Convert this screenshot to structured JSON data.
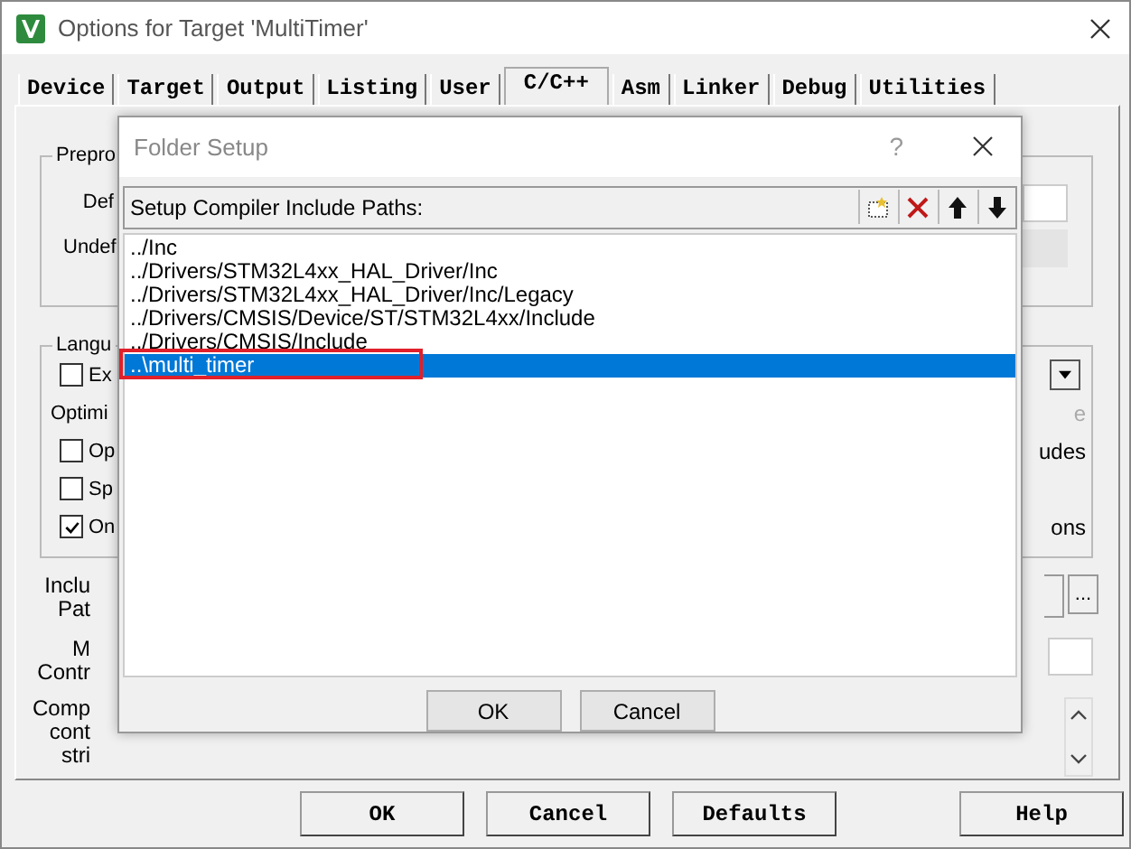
{
  "window": {
    "title": "Options for Target 'MultiTimer'"
  },
  "tabs": [
    {
      "label": "Device",
      "selected": false
    },
    {
      "label": "Target",
      "selected": false
    },
    {
      "label": "Output",
      "selected": false
    },
    {
      "label": "Listing",
      "selected": false
    },
    {
      "label": "User",
      "selected": false
    },
    {
      "label": "C/C++",
      "selected": true
    },
    {
      "label": "Asm",
      "selected": false
    },
    {
      "label": "Linker",
      "selected": false
    },
    {
      "label": "Debug",
      "selected": false
    },
    {
      "label": "Utilities",
      "selected": false
    }
  ],
  "preprocessor": {
    "legend": "Prepro",
    "rows": [
      {
        "label": "Def",
        "disabled": false
      },
      {
        "label": "Undef",
        "disabled": true
      }
    ]
  },
  "language": {
    "legend": "Langu",
    "rows": [
      {
        "kind": "checkbox",
        "label": "Ex",
        "checked": false,
        "right": {
          "kind": "dropdown"
        }
      },
      {
        "kind": "heading",
        "label": "Optimi",
        "right": {
          "kind": "text",
          "text": "e",
          "disabled": true
        }
      },
      {
        "kind": "checkbox",
        "label": "Op",
        "checked": false,
        "right": {
          "kind": "text",
          "text": "udes",
          "disabled": false
        }
      },
      {
        "kind": "checkbox",
        "label": "Sp",
        "checked": false
      },
      {
        "kind": "checkbox",
        "label": "On",
        "checked": true,
        "right": {
          "kind": "text",
          "text": "ons",
          "disabled": false
        }
      }
    ]
  },
  "include_paths": {
    "label_lines": [
      "Inclu",
      "Pat"
    ],
    "browse": "..."
  },
  "misc_controls": {
    "label_lines": [
      "M",
      "Contr"
    ]
  },
  "compiler_control": {
    "label_lines": [
      "Comp",
      "cont",
      "stri"
    ]
  },
  "buttons": [
    "OK",
    "Cancel",
    "Defaults",
    "Help"
  ],
  "folder_setup": {
    "title": "Folder Setup",
    "help": "?",
    "toolbar_label": "Setup Compiler Include Paths:",
    "paths": [
      {
        "text": "../Inc",
        "selected": false,
        "highlighted": false
      },
      {
        "text": "../Drivers/STM32L4xx_HAL_Driver/Inc",
        "selected": false,
        "highlighted": false
      },
      {
        "text": "../Drivers/STM32L4xx_HAL_Driver/Inc/Legacy",
        "selected": false,
        "highlighted": false
      },
      {
        "text": "../Drivers/CMSIS/Device/ST/STM32L4xx/Include",
        "selected": false,
        "highlighted": false
      },
      {
        "text": "../Drivers/CMSIS/Include",
        "selected": false,
        "highlighted": false
      },
      {
        "text": "..\\multi_timer",
        "selected": true,
        "highlighted": true
      }
    ],
    "buttons": [
      "OK",
      "Cancel"
    ]
  }
}
